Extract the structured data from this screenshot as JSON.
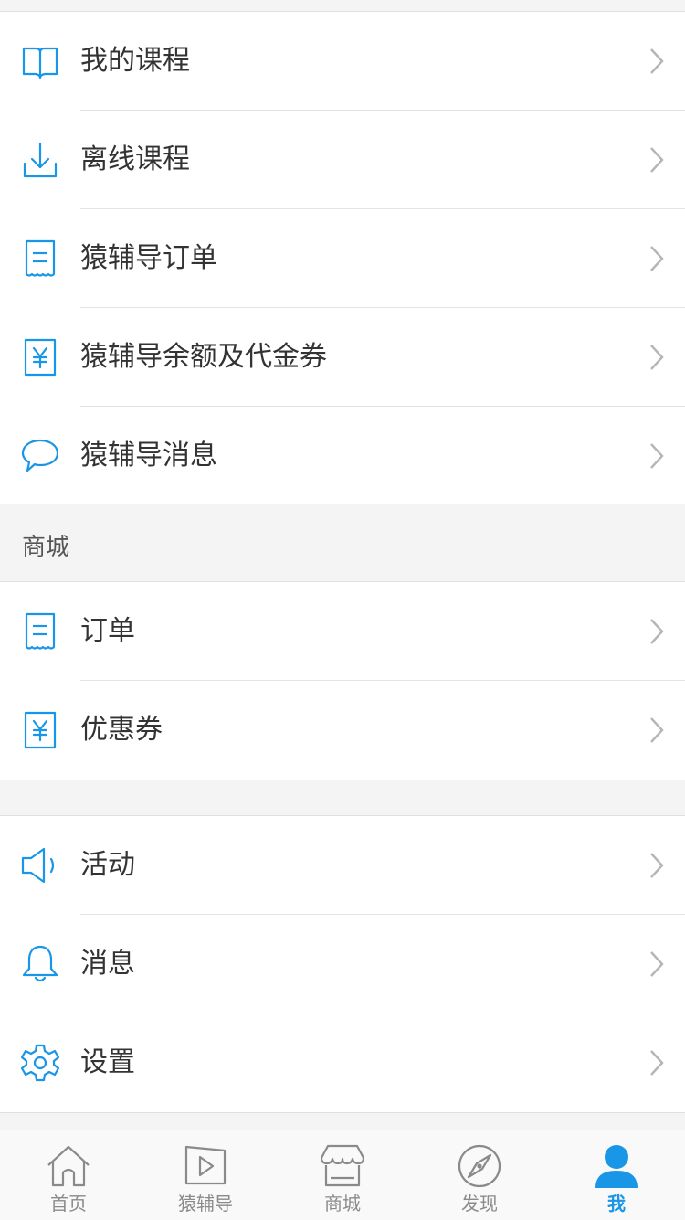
{
  "colors": {
    "accent": "#1a96e6",
    "text": "#333333",
    "muted": "#8a8a8a",
    "background": "#f4f4f4"
  },
  "group1": {
    "items": [
      {
        "label": "我的课程",
        "icon": "book-icon"
      },
      {
        "label": "离线课程",
        "icon": "download-icon"
      },
      {
        "label": "猿辅导订单",
        "icon": "receipt-icon"
      },
      {
        "label": "猿辅导余额及代金券",
        "icon": "yen-voucher-icon"
      },
      {
        "label": "猿辅导消息",
        "icon": "chat-bubble-icon"
      }
    ]
  },
  "mall_section": {
    "title": "商城",
    "items": [
      {
        "label": "订单",
        "icon": "receipt-icon"
      },
      {
        "label": "优惠券",
        "icon": "yen-voucher-icon"
      }
    ]
  },
  "group3": {
    "items": [
      {
        "label": "活动",
        "icon": "speaker-icon"
      },
      {
        "label": "消息",
        "icon": "bell-icon"
      },
      {
        "label": "设置",
        "icon": "gear-icon"
      }
    ]
  },
  "tabbar": {
    "tabs": [
      {
        "label": "首页",
        "icon": "home-icon",
        "active": false
      },
      {
        "label": "猿辅导",
        "icon": "play-icon",
        "active": false
      },
      {
        "label": "商城",
        "icon": "store-icon",
        "active": false
      },
      {
        "label": "发现",
        "icon": "compass-icon",
        "active": false
      },
      {
        "label": "我",
        "icon": "person-icon",
        "active": true
      }
    ]
  }
}
